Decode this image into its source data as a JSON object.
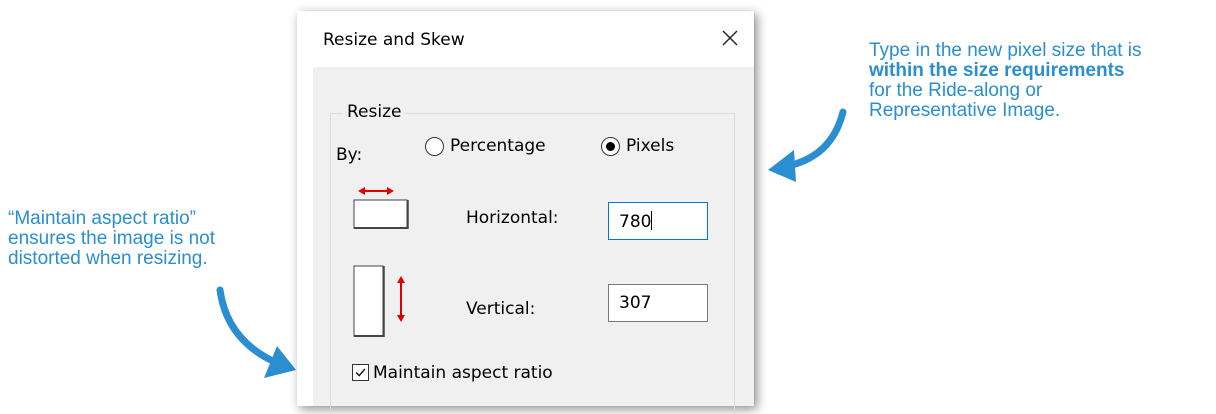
{
  "dialog": {
    "title": "Resize and Skew",
    "group_label": "Resize",
    "by_label": "By:",
    "options": [
      {
        "label": "Percentage",
        "selected": false
      },
      {
        "label": "Pixels",
        "selected": true
      }
    ],
    "horizontal": {
      "label": "Horizontal:",
      "value": "780"
    },
    "vertical": {
      "label": "Vertical:",
      "value": "307"
    },
    "maintain_aspect": {
      "label": "Maintain aspect ratio",
      "checked": true
    }
  },
  "notes": {
    "left": {
      "line1": "“Maintain aspect ratio”",
      "line2": "ensures the image is not",
      "line3": "distorted when resizing."
    },
    "right": {
      "line1": "Type in the new pixel size that is",
      "line2_bold": "within the size requirements",
      "line3": "for the Ride-along or",
      "line4": "Representative Image."
    }
  },
  "colors": {
    "annotation": "#2a8ed0",
    "focus_border": "#0078d7",
    "icon_arrow": "#e00000",
    "dialog_bg": "#f0f0f0"
  }
}
